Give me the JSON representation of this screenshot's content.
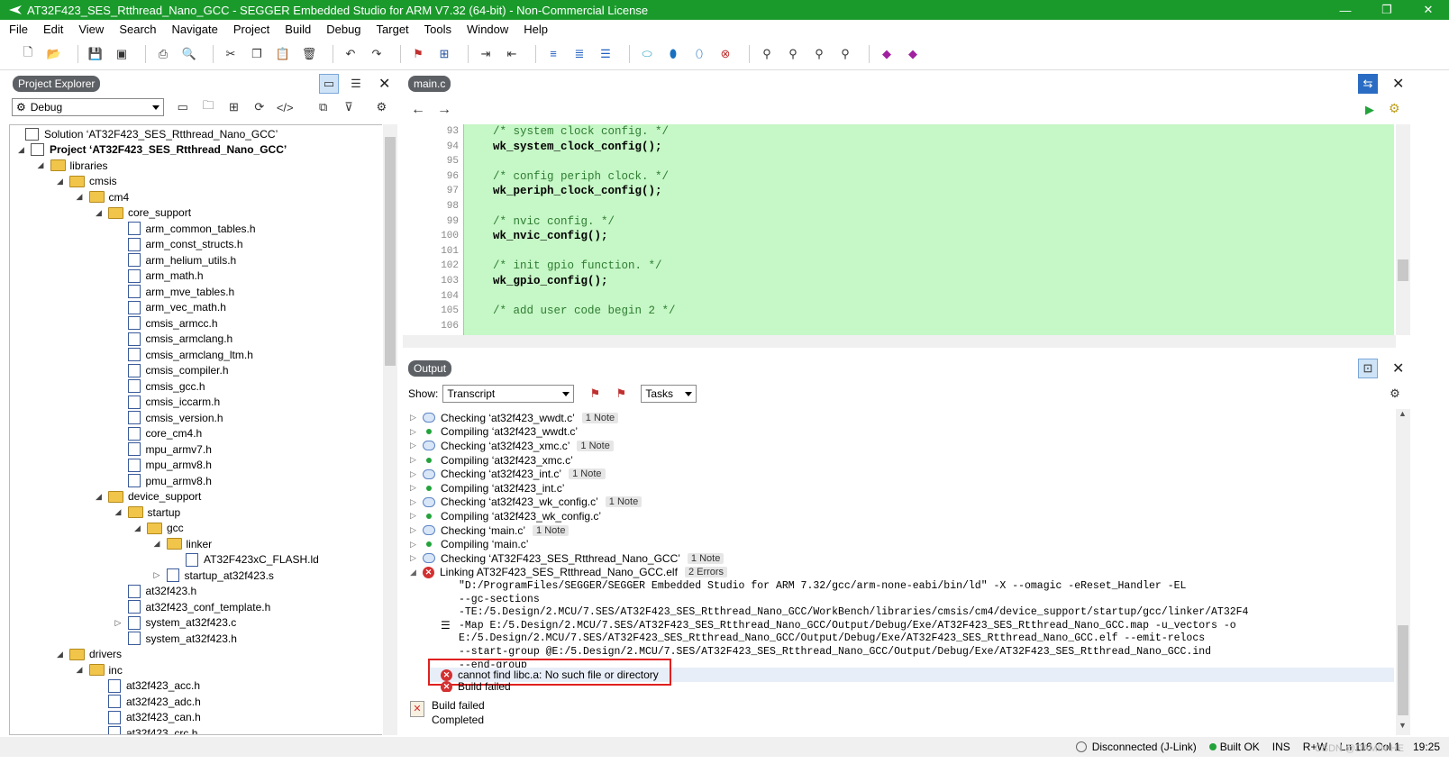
{
  "window": {
    "title": "AT32F423_SES_Rtthread_Nano_GCC - SEGGER Embedded Studio for ARM V7.32 (64-bit) - Non-Commercial License",
    "minimize": "—",
    "maximize": "❐",
    "close": "✕"
  },
  "menu": [
    "File",
    "Edit",
    "View",
    "Search",
    "Navigate",
    "Project",
    "Build",
    "Debug",
    "Target",
    "Tools",
    "Window",
    "Help"
  ],
  "project_explorer": {
    "title": "Project Explorer",
    "config": "Debug",
    "tree": [
      {
        "label": "Solution ‘AT32F423_SES_Rtthread_Nano_GCC’",
        "level": 0,
        "type": "solution",
        "expander": ""
      },
      {
        "label": "Project ‘AT32F423_SES_Rtthread_Nano_GCC’",
        "level": 0,
        "type": "project",
        "expander": "◢",
        "bold": true
      },
      {
        "label": "libraries",
        "level": 1,
        "type": "folder",
        "expander": "◢"
      },
      {
        "label": "cmsis",
        "level": 2,
        "type": "folder",
        "expander": "◢"
      },
      {
        "label": "cm4",
        "level": 3,
        "type": "folder",
        "expander": "◢"
      },
      {
        "label": "core_support",
        "level": 4,
        "type": "folder",
        "expander": "◢"
      },
      {
        "label": "arm_common_tables.h",
        "level": 5,
        "type": "h"
      },
      {
        "label": "arm_const_structs.h",
        "level": 5,
        "type": "h"
      },
      {
        "label": "arm_helium_utils.h",
        "level": 5,
        "type": "h"
      },
      {
        "label": "arm_math.h",
        "level": 5,
        "type": "h"
      },
      {
        "label": "arm_mve_tables.h",
        "level": 5,
        "type": "h"
      },
      {
        "label": "arm_vec_math.h",
        "level": 5,
        "type": "h"
      },
      {
        "label": "cmsis_armcc.h",
        "level": 5,
        "type": "h"
      },
      {
        "label": "cmsis_armclang.h",
        "level": 5,
        "type": "h"
      },
      {
        "label": "cmsis_armclang_ltm.h",
        "level": 5,
        "type": "h"
      },
      {
        "label": "cmsis_compiler.h",
        "level": 5,
        "type": "h"
      },
      {
        "label": "cmsis_gcc.h",
        "level": 5,
        "type": "h"
      },
      {
        "label": "cmsis_iccarm.h",
        "level": 5,
        "type": "h"
      },
      {
        "label": "cmsis_version.h",
        "level": 5,
        "type": "h"
      },
      {
        "label": "core_cm4.h",
        "level": 5,
        "type": "h"
      },
      {
        "label": "mpu_armv7.h",
        "level": 5,
        "type": "h"
      },
      {
        "label": "mpu_armv8.h",
        "level": 5,
        "type": "h"
      },
      {
        "label": "pmu_armv8.h",
        "level": 5,
        "type": "h"
      },
      {
        "label": "device_support",
        "level": 4,
        "type": "folder",
        "expander": "◢"
      },
      {
        "label": "startup",
        "level": 5,
        "type": "folder",
        "expander": "◢"
      },
      {
        "label": "gcc",
        "level": 6,
        "type": "folder",
        "expander": "◢"
      },
      {
        "label": "linker",
        "level": 7,
        "type": "folder",
        "expander": "◢"
      },
      {
        "label": "AT32F423xC_FLASH.ld",
        "level": 8,
        "type": "file"
      },
      {
        "label": "startup_at32f423.s",
        "level": 7,
        "type": "asm",
        "expander": "▷"
      },
      {
        "label": "at32f423.h",
        "level": 5,
        "type": "h"
      },
      {
        "label": "at32f423_conf_template.h",
        "level": 5,
        "type": "h"
      },
      {
        "label": "system_at32f423.c",
        "level": 5,
        "type": "c",
        "expander": "▷"
      },
      {
        "label": "system_at32f423.h",
        "level": 5,
        "type": "h"
      },
      {
        "label": "drivers",
        "level": 2,
        "type": "folder",
        "expander": "◢"
      },
      {
        "label": "inc",
        "level": 3,
        "type": "folder",
        "expander": "◢"
      },
      {
        "label": "at32f423_acc.h",
        "level": 4,
        "type": "h"
      },
      {
        "label": "at32f423_adc.h",
        "level": 4,
        "type": "h"
      },
      {
        "label": "at32f423_can.h",
        "level": 4,
        "type": "h"
      },
      {
        "label": "at32f423_crc.h",
        "level": 4,
        "type": "h"
      }
    ]
  },
  "editor": {
    "tab": "main.c",
    "lines": [
      {
        "n": "93",
        "text": "/* system clock config. */",
        "kind": "comment"
      },
      {
        "n": "94",
        "text": "wk_system_clock_config();",
        "kind": "code"
      },
      {
        "n": "95",
        "text": "",
        "kind": "code"
      },
      {
        "n": "96",
        "text": "/* config periph clock. */",
        "kind": "comment"
      },
      {
        "n": "97",
        "text": "wk_periph_clock_config();",
        "kind": "code"
      },
      {
        "n": "98",
        "text": "",
        "kind": "code"
      },
      {
        "n": "99",
        "text": "/* nvic config. */",
        "kind": "comment"
      },
      {
        "n": "100",
        "text": "wk_nvic_config();",
        "kind": "code"
      },
      {
        "n": "101",
        "text": "",
        "kind": "code"
      },
      {
        "n": "102",
        "text": "/* init gpio function. */",
        "kind": "comment"
      },
      {
        "n": "103",
        "text": "wk_gpio_config();",
        "kind": "code"
      },
      {
        "n": "104",
        "text": "",
        "kind": "code"
      },
      {
        "n": "105",
        "text": "/* add user code begin 2 */",
        "kind": "comment"
      },
      {
        "n": "106",
        "text": "",
        "kind": "code"
      }
    ]
  },
  "output": {
    "title": "Output",
    "show_label": "Show:",
    "show_value": "Transcript",
    "tasks_value": "Tasks",
    "rows": [
      {
        "kind": "check",
        "text": "Checking ‘at32f423_wwdt.c’",
        "badge": "1 Note"
      },
      {
        "kind": "compile",
        "text": "Compiling ‘at32f423_wwdt.c’",
        "badge": ""
      },
      {
        "kind": "check",
        "text": "Checking ‘at32f423_xmc.c’",
        "badge": "1 Note"
      },
      {
        "kind": "compile",
        "text": "Compiling ‘at32f423_xmc.c’",
        "badge": ""
      },
      {
        "kind": "check",
        "text": "Checking ‘at32f423_int.c’",
        "badge": "1 Note"
      },
      {
        "kind": "compile",
        "text": "Compiling ‘at32f423_int.c’",
        "badge": ""
      },
      {
        "kind": "check",
        "text": "Checking ‘at32f423_wk_config.c’",
        "badge": "1 Note"
      },
      {
        "kind": "compile",
        "text": "Compiling ‘at32f423_wk_config.c’",
        "badge": ""
      },
      {
        "kind": "check",
        "text": "Checking ‘main.c’",
        "badge": "1 Note"
      },
      {
        "kind": "compile",
        "text": "Compiling ‘main.c’",
        "badge": ""
      },
      {
        "kind": "check",
        "text": "Checking ‘AT32F423_SES_Rtthread_Nano_GCC’",
        "badge": "1 Note"
      },
      {
        "kind": "error",
        "text": "Linking AT32F423_SES_Rtthread_Nano_GCC.elf",
        "badge": "2 Errors"
      }
    ],
    "command_lines": [
      "\"D:/ProgramFiles/SEGGER/SEGGER Embedded Studio for ARM 7.32/gcc/arm-none-eabi/bin/ld\" -X --omagic -eReset_Handler -EL",
      "--gc-sections",
      "-TE:/5.Design/2.MCU/7.SES/AT32F423_SES_Rtthread_Nano_GCC/WorkBench/libraries/cmsis/cm4/device_support/startup/gcc/linker/AT32F4",
      "-Map E:/5.Design/2.MCU/7.SES/AT32F423_SES_Rtthread_Nano_GCC/Output/Debug/Exe/AT32F423_SES_Rtthread_Nano_GCC.map -u_vectors -o",
      "E:/5.Design/2.MCU/7.SES/AT32F423_SES_Rtthread_Nano_GCC/Output/Debug/Exe/AT32F423_SES_Rtthread_Nano_GCC.elf --emit-relocs",
      "--start-group @E:/5.Design/2.MCU/7.SES/AT32F423_SES_Rtthread_Nano_GCC/Output/Debug/Exe/AT32F423_SES_Rtthread_Nano_GCC.ind",
      "--end-group"
    ],
    "error_line": "cannot find libc.a: No such file or directory",
    "build_failed_line": "Build failed",
    "summary_title": "Build failed",
    "summary_sub": "Completed"
  },
  "status": {
    "connection": "Disconnected (J-Link)",
    "build": "Built OK",
    "ins": "INS",
    "rw": "R+W",
    "position": "Ln 116 Col 1",
    "time": "19:25",
    "watermark": "CSDN @DAMIN HE"
  },
  "colors": {
    "titlebar": "#1b9a2c",
    "code_bg": "#c6f7c6",
    "error_red": "#d43030",
    "highlight_box": "#e02020"
  }
}
